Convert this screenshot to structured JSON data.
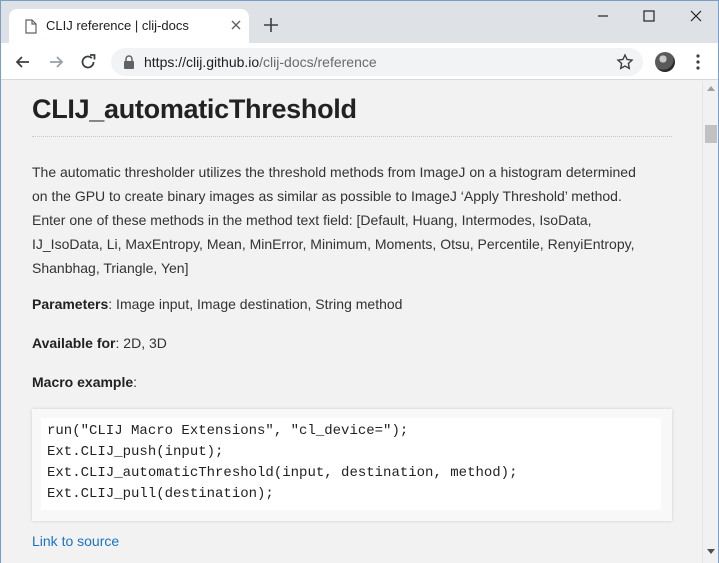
{
  "browser": {
    "tab_title": "CLIJ reference | clij-docs",
    "url_host": "https://clij.github.io",
    "url_path": "/clij-docs/reference"
  },
  "icons": {
    "tab_favicon": "document-icon",
    "tab_close": "close-icon",
    "new_tab": "plus-icon",
    "back": "arrow-left-icon",
    "forward": "arrow-right-icon",
    "reload": "reload-icon",
    "lock": "lock-icon",
    "bookmark": "star-icon",
    "profile": "avatar",
    "menu": "kebab-menu-icon",
    "minimize": "minimize-icon",
    "maximize": "maximize-icon",
    "close_window": "close-window-icon"
  },
  "content": {
    "title": "CLIJ_automaticThreshold",
    "description_lines": [
      "The automatic thresholder utilizes the threshold methods from ImageJ on a histogram determined",
      "on the GPU to create binary images as similar as possible to ImageJ ‘Apply Threshold’ method.",
      "Enter one of these methods in the method text field: [Default, Huang, Intermodes, IsoData,",
      "IJ_IsoData, Li, MaxEntropy, Mean, MinError, Minimum, Moments, Otsu, Percentile, RenyiEntropy,",
      "Shanbhag, Triangle, Yen]"
    ],
    "parameters_label": "Parameters",
    "parameters_value": ": Image input, Image destination, String method",
    "available_label": "Available for",
    "available_value": ": 2D, 3D",
    "macro_label": "Macro example",
    "macro_suffix": ":",
    "code_lines": [
      "run(\"CLIJ Macro Extensions\", \"cl_device=\");",
      "Ext.CLIJ_push(input);",
      "Ext.CLIJ_automaticThreshold(input, destination, method);",
      "Ext.CLIJ_pull(destination);"
    ],
    "source_link": "Link to source"
  },
  "colors": {
    "link": "#1a73c6",
    "page_bg": "#f2f2f2",
    "tabstrip_bg": "#dee1e6"
  }
}
